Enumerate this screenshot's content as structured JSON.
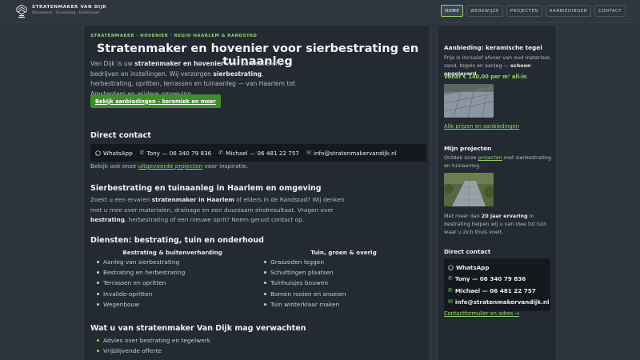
{
  "header": {
    "brand_name": "STRATENMAKER VAN DIJK",
    "brand_tagline": "Straatwerk · Tuinaanleg · Onderhoud",
    "nav": [
      {
        "label": "HOME",
        "active": true
      },
      {
        "label": "WERKWIJZE",
        "active": false
      },
      {
        "label": "PROJECTEN",
        "active": false
      },
      {
        "label": "AANBIEDINGEN",
        "active": false
      },
      {
        "label": "CONTACT",
        "active": false
      }
    ]
  },
  "hero": {
    "breadcrumb": "STRATENMAKER · HOVENIER · REGIO HAARLEM & RANDSTAD",
    "title": "Stratenmaker en hovenier voor sierbestrating en tuinaanleg",
    "intro_1": "Van Dijk is uw ",
    "intro_b1": "stratenmaker en hovenier",
    "intro_2": " voor particulieren, bedrijven en instellingen. Wij verzorgen ",
    "intro_b2": "sierbestrating",
    "intro_3": ", herbestrating, opritten, terrassen en tuinaanleg — van Haarlem tot Amsterdam en wijdere omgeving.",
    "cta_label": "Bekijk aanbiedingen – keramiek en meer"
  },
  "direct_contact": {
    "title": "Direct contact",
    "whatsapp": "WhatsApp",
    "tony": "Tony —  06 340 79 836",
    "michael": "Michael —  06 481 22 757",
    "email": "info@stratenmakervandijk.nl",
    "projects_pre": "Bekijk ook onze ",
    "projects_link": "uitgevoerde projecten",
    "projects_post": " voor inspiratie."
  },
  "haarlem": {
    "title": "Sierbestrating en tuinaanleg in Haarlem en omgeving",
    "p1": "Zoekt u een ervaren ",
    "b1": "stratenmaker in Haarlem",
    "p2": " of elders in de Randstad? Wij denken met u mee over materialen, drainage en een duurzaam eindresultaat. Vragen over ",
    "b2": "bestrating",
    "p3": ", herbestrating of een nieuwe oprit? Neem gerust contact op."
  },
  "services": {
    "title": "Diensten: bestrating, tuin en onderhoud",
    "col1_title": "Bestrating & buitenverharding",
    "col1_items": [
      "Aanleg van sierbestrating",
      "Bestrating en herbestrating",
      "Terrassen en opritten",
      "Invalide-opritten",
      "Wegenbouw"
    ],
    "col2_title": "Tuin, groen & overig",
    "col2_items": [
      "Graszoden leggen",
      "Schuttingen plaatsen",
      "Tuinhuisjes bouwen",
      "Bomen rooien en snoeien",
      "Tuin winterklaar maken"
    ]
  },
  "why": {
    "title": "Wat u van stratenmaker Van Dijk mag verwachten",
    "items": [
      "Advies over bestrating en tegelwerk",
      "Vrijblijvende offerte"
    ]
  },
  "sidebar": {
    "offer_title": "Aanbieding: keramische tegel",
    "offer_text": "Prijs is inclusief afvoer van oud materiaal, zand, tegels en aanleg — ",
    "offer_bold": "schoon opgeleverd",
    "offer_price": "Vanaf € 140,00 per m² all-in",
    "offer_link": "Alle prijzen en aanbiedingen",
    "projects_title": "Mijn projecten",
    "projects_pre": "Ontdek onze ",
    "projects_link": "projecten",
    "projects_post": " met sierbestrating en tuinaanleg.",
    "exp_pre": "Met meer dan ",
    "exp_bold": "20 jaar ervaring",
    "exp_post": " in bestrating helpen wij u van idee tot tuin waar u zich thuis voelt.",
    "contact_title": "Direct contact",
    "whatsapp": "WhatsApp",
    "tony": "Tony — 06 340 79 836",
    "michael": "Michael — 06 481 22 757",
    "email": "info@stratenmakervandijk.nl",
    "contact_link": "Contactformulier en adres →"
  },
  "colors": {
    "accent": "#8fd46a",
    "cta": "#3d8f2a",
    "background": "#2c333c",
    "panel": "#232a32"
  },
  "icons": [
    "logo-mark",
    "whatsapp-icon",
    "phone-icon",
    "mail-icon"
  ]
}
